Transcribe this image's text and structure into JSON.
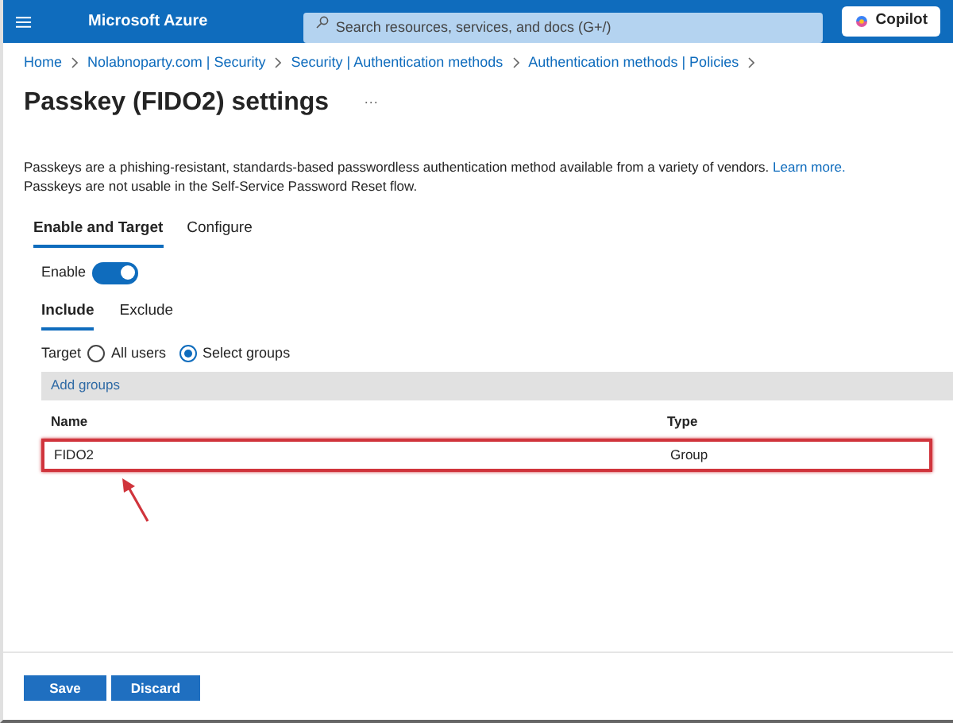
{
  "topbar": {
    "brand": "Microsoft Azure",
    "search": {
      "placeholder": "Search resources, services, and docs (G+/)"
    },
    "copilot": "Copilot"
  },
  "breadcrumb": [
    "Home",
    "Nolabnoparty.com | Security",
    "Security | Authentication methods",
    "Authentication methods | Policies"
  ],
  "title": "Passkey (FIDO2) settings",
  "more": "···",
  "description": {
    "text": "Passkeys are a phishing-resistant, standards-based passwordless authentication method available from a variety of vendors.",
    "link": "Learn more.",
    "note": "Passkeys are not usable in the Self-Service Password Reset flow."
  },
  "tabs": [
    {
      "label": "Enable and Target",
      "selected": true
    },
    {
      "label": "Configure",
      "selected": false
    }
  ],
  "enable": {
    "label": "Enable",
    "on": true
  },
  "subtabs": [
    {
      "label": "Include",
      "selected": true
    },
    {
      "label": "Exclude",
      "selected": false
    }
  ],
  "target": {
    "label": "Target",
    "options": [
      {
        "label": "All users",
        "selected": false
      },
      {
        "label": "Select groups",
        "selected": true
      }
    ]
  },
  "add_groups": "Add groups",
  "table": {
    "columns": [
      "Name",
      "Type"
    ],
    "rows": [
      {
        "cells": [
          "FIDO2",
          "Group"
        ],
        "highlighted": true
      }
    ]
  },
  "buttons": [
    "Save",
    "Discard"
  ]
}
